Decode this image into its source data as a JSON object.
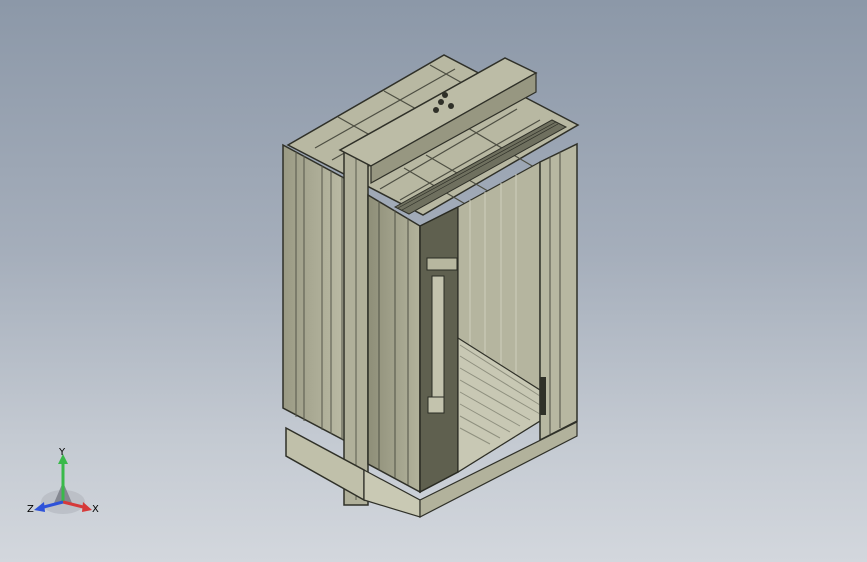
{
  "viewport": {
    "background_top": "#8c98a8",
    "background_bottom": "#d3d7dd"
  },
  "model": {
    "body_color": "#a9a98f",
    "dark_color": "#5f604f",
    "edge_color": "#2f3028"
  },
  "triad": {
    "x_label": "X",
    "y_label": "Y",
    "z_label": "Z",
    "x_color": "#d63a3a",
    "y_color": "#39b94a",
    "z_color": "#2f53d9"
  }
}
